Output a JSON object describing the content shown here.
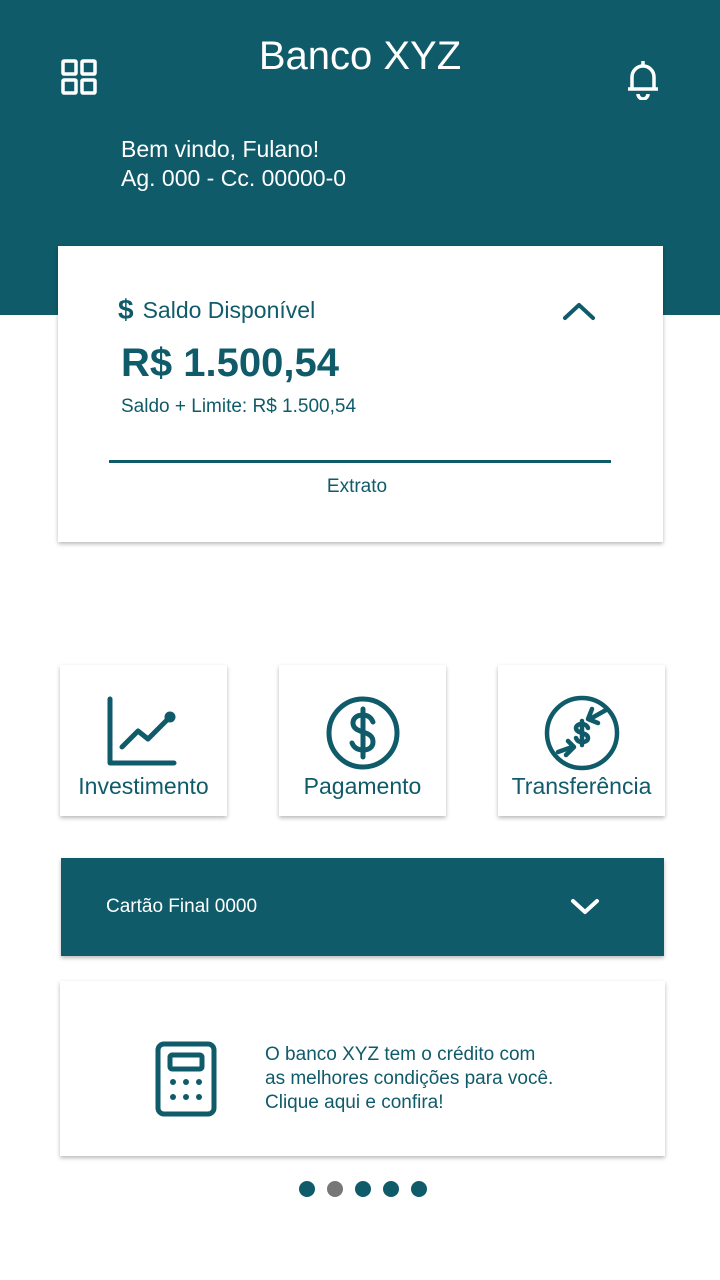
{
  "header": {
    "title": "Banco XYZ",
    "welcome": "Bem vindo, Fulano!",
    "account": "Ag. 000 - Cc. 00000-0",
    "menu_icon": "grid-icon",
    "notification_icon": "bell-icon"
  },
  "balance": {
    "currency_symbol": "$",
    "label": "Saldo Disponível",
    "amount": "R$ 1.500,54",
    "limit_text": "Saldo + Limite: R$ 1.500,54",
    "statement_link": "Extrato",
    "toggle_icon": "chevron-up-icon"
  },
  "actions": [
    {
      "label": "Investimento",
      "icon": "chart-line-icon"
    },
    {
      "label": "Pagamento",
      "icon": "dollar-circle-icon"
    },
    {
      "label": "Transferência",
      "icon": "transfer-icon"
    }
  ],
  "card": {
    "label": "Cartão Final 0000",
    "toggle_icon": "chevron-down-icon"
  },
  "promo": {
    "icon": "calculator-icon",
    "lines": [
      "O banco XYZ tem o crédito com",
      "as melhores condições para você.",
      "Clique aqui e confira!"
    ]
  },
  "carousel": {
    "total": 5,
    "active_index": 1
  },
  "colors": {
    "primary": "#0f5b6a",
    "background": "#ffffff",
    "dot_active": "#777777"
  }
}
